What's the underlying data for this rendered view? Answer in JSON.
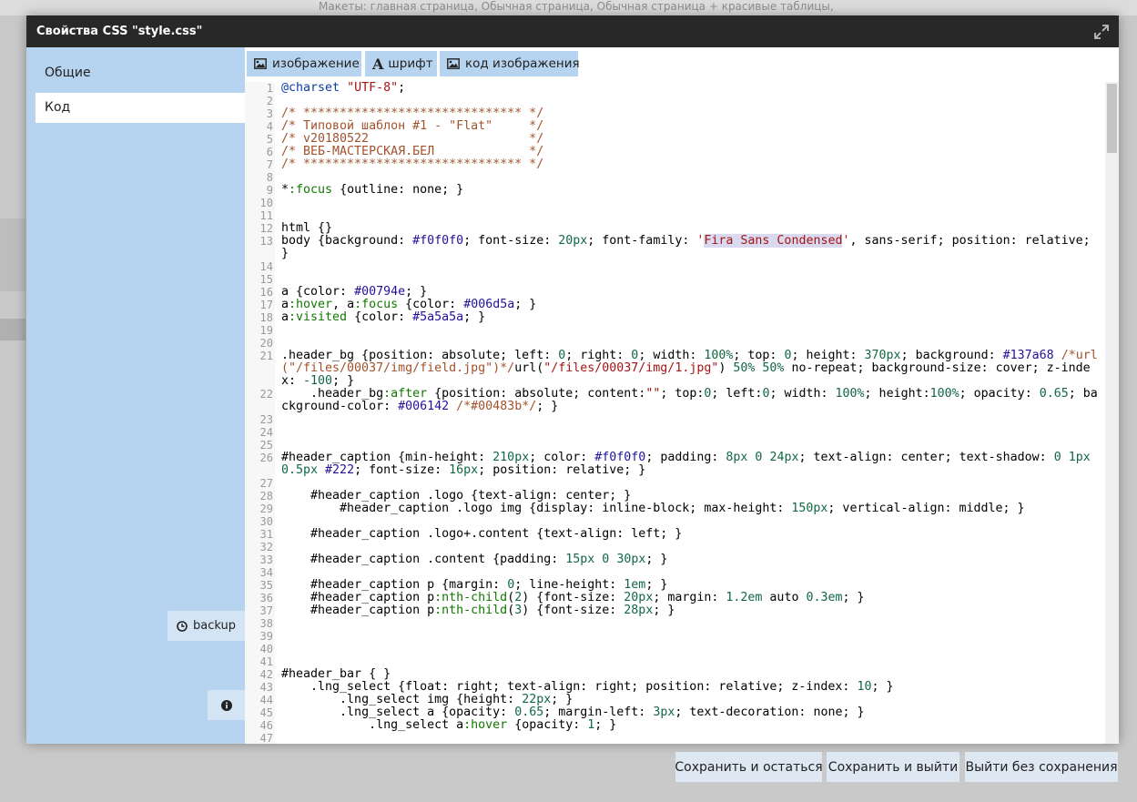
{
  "background": {
    "top_text": "Макеты: главная страница, Обычная страница, Обычная страница + красивые таблицы,"
  },
  "dialog": {
    "title": "Свойства CSS \"style.css\"",
    "expand_icon": "expand-icon"
  },
  "sidebar": {
    "items": [
      {
        "label": "Общие",
        "active": false
      },
      {
        "label": "Код",
        "active": true
      }
    ],
    "backup_label": "backup",
    "info_icon": "info-icon"
  },
  "toolbar": {
    "image_label": "изображение",
    "font_label": "шрифт",
    "image_code_label": "код изображения"
  },
  "editor": {
    "lines": [
      "@charset \"UTF-8\";",
      "",
      "/* ****************************** */",
      "/* Типовой шаблон #1 - \"Flat\"     */",
      "/* v20180522                      */",
      "/* ВЕБ-МАСТЕРСКАЯ.БЕЛ             */",
      "/* ****************************** */",
      "",
      "*:focus {outline: none; }",
      "",
      "",
      "html {}",
      "body {background: #f0f0f0; font-size: 20px; font-family: 'Fira Sans Condensed', sans-serif; position: relative; }",
      "",
      "",
      "a {color: #00794e; }",
      "a:hover, a:focus {color: #006d5a; }",
      "a:visited {color: #5a5a5a; }",
      "",
      "",
      ".header_bg {position: absolute; left: 0; right: 0; width: 100%; top: 0; height: 370px; background: #137a68 /*url(\"/files/00037/img/field.jpg\")*/url(\"/files/00037/img/1.jpg\") 50% 50% no-repeat; background-size: cover; z-index: -100; }",
      "    .header_bg:after {position: absolute; content:\"\"; top:0; left:0; width: 100%; height:100%; opacity: 0.65; background-color: #006142 /*#00483b*/; }",
      "",
      "",
      "",
      "#header_caption {min-height: 210px; color: #f0f0f0; padding: 8px 0 24px; text-align: center; text-shadow: 0 1px 0.5px #222; font-size: 16px; position: relative; }",
      "",
      "    #header_caption .logo {text-align: center; }",
      "        #header_caption .logo img {display: inline-block; max-height: 150px; vertical-align: middle; }",
      "",
      "    #header_caption .logo+.content {text-align: left; }",
      "",
      "    #header_caption .content {padding: 15px 0 30px; }",
      "",
      "    #header_caption p {margin: 0; line-height: 1em; }",
      "    #header_caption p:nth-child(2) {font-size: 20px; margin: 1.2em auto 0.3em; }",
      "    #header_caption p:nth-child(3) {font-size: 28px; }",
      "",
      "",
      "",
      "",
      "#header_bar { }",
      "    .lng_select {float: right; text-align: right; position: relative; z-index: 10; }",
      "        .lng_select img {height: 22px; }",
      "        .lng_select a {opacity: 0.65; margin-left: 3px; text-decoration: none; }",
      "            .lng_select a:hover {opacity: 1; }",
      ""
    ]
  },
  "footer": {
    "save_stay_label": "Сохранить и остаться",
    "save_exit_label": "Сохранить и выйти",
    "exit_nosave_label": "Выйти без сохранения"
  }
}
